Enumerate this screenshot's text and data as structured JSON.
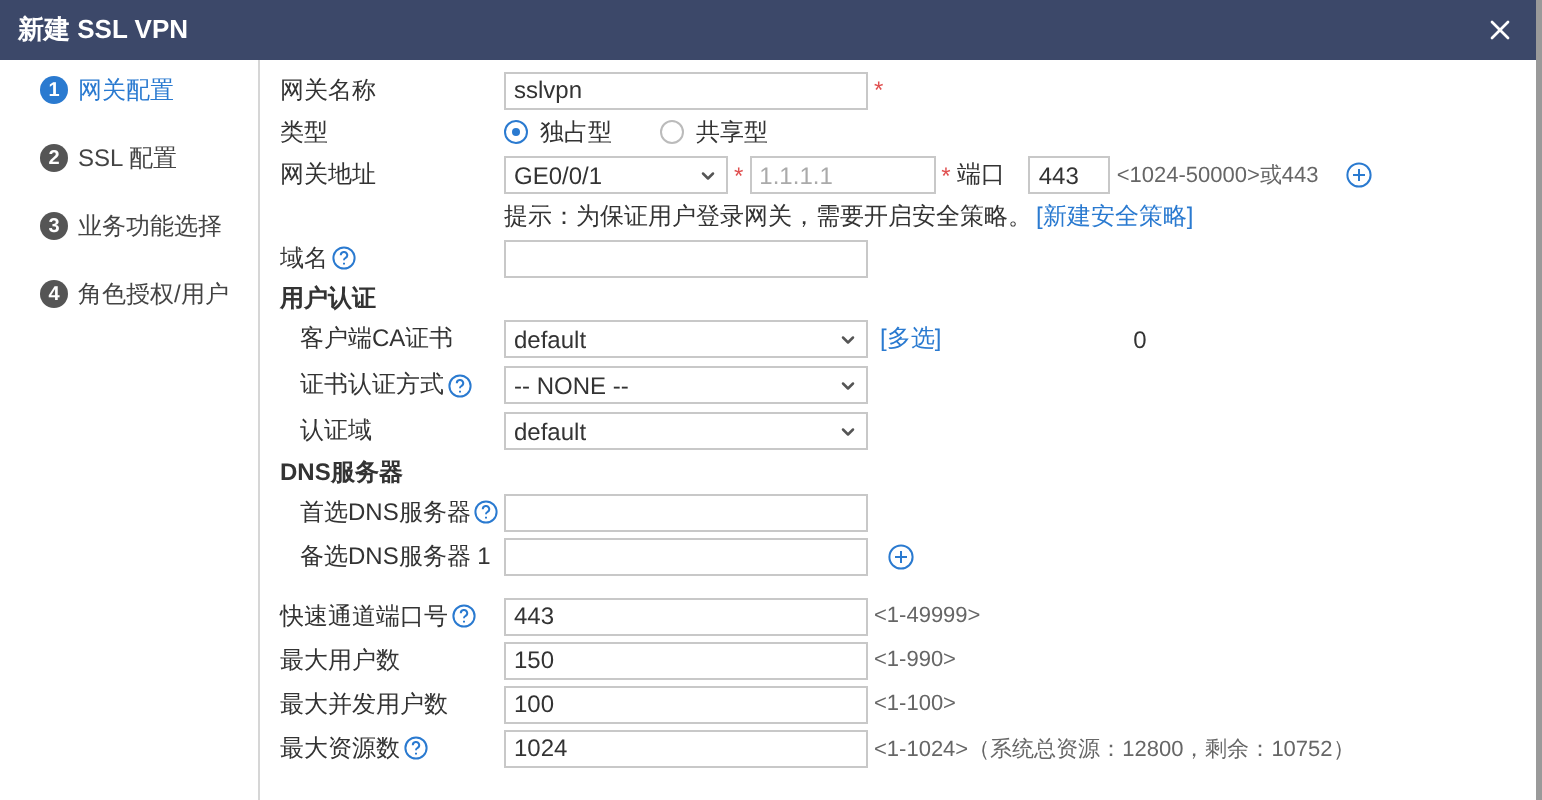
{
  "window": {
    "title": "新建 SSL VPN"
  },
  "steps": [
    {
      "number": "1",
      "label": "网关配置",
      "selected": true
    },
    {
      "number": "2",
      "label": "SSL 配置",
      "selected": false
    },
    {
      "number": "3",
      "label": "业务功能选择",
      "selected": false
    },
    {
      "number": "4",
      "label": "角色授权/用户",
      "selected": false
    }
  ],
  "sections": [
    {
      "rows": [
        {
          "kind": "input",
          "label": "网关名称",
          "value": "sslvpn",
          "required_mark": "*"
        },
        {
          "kind": "radio",
          "label": "类型",
          "options": [
            {
              "label": "独占型",
              "selected": true
            },
            {
              "label": "共享型",
              "selected": false
            }
          ]
        },
        {
          "kind": "gateway",
          "label": "网关地址",
          "interface": "GE0/0/1",
          "interface_mark": "*",
          "ip_mark": "*",
          "ip_placeholder": "1.1.1.1",
          "port_label": "端口",
          "port": "443",
          "port_range": "<1024-50000>或443"
        },
        {
          "kind": "hint",
          "text": "提示：为保证用户登录网关，需要开启安全策略。",
          "link": "[新建安全策略]"
        },
        {
          "kind": "input",
          "label": "域名",
          "help": true
        },
        {
          "kind": "heading",
          "label": "用户认证",
          "children": [
            {
              "kind": "select",
              "label": "客户端CA证书",
              "value": "default",
              "link": "[多选]",
              "note": "0"
            },
            {
              "kind": "select",
              "label": "证书认证方式",
              "value": "-- NONE --",
              "help": true
            },
            {
              "kind": "select",
              "label": "认证域",
              "value": "default"
            }
          ]
        },
        {
          "kind": "heading",
          "label": "DNS服务器",
          "children": [
            {
              "kind": "input",
              "label": "首选DNS服务器",
              "help": true
            },
            {
              "kind": "input",
              "label": "备选DNS服务器 1",
              "add": true
            }
          ]
        }
      ]
    },
    {
      "rows": [
        {
          "kind": "input",
          "label": "快速通道端口号",
          "help": true,
          "value": "443",
          "range": "<1-49999>"
        },
        {
          "kind": "input",
          "label": "最大用户数",
          "value": "150",
          "range": "<1-990>"
        },
        {
          "kind": "input",
          "label": "最大并发用户数",
          "value": "100",
          "range": "<1-100>"
        },
        {
          "kind": "input",
          "label": "最大资源数",
          "help": true,
          "value": "1024",
          "range": "<1-1024>（系统总资源：12800，剩余：10752）"
        }
      ]
    }
  ]
}
